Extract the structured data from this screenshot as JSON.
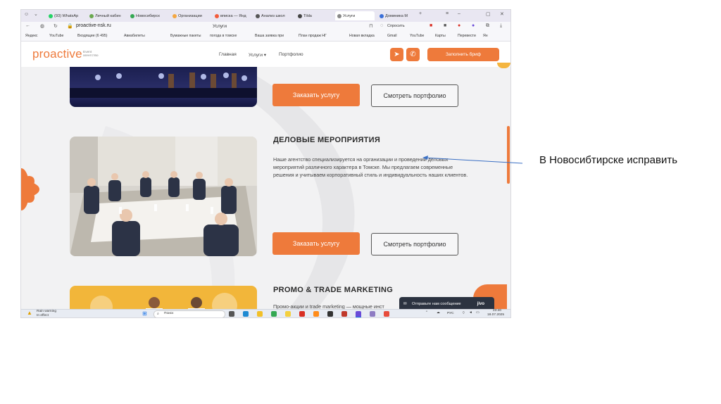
{
  "browser": {
    "tabs": [
      {
        "label": "(93) WhatsAp",
        "color": "#25d366"
      },
      {
        "label": "Личный кабин",
        "color": "#6aa84f"
      },
      {
        "label": "Новосибирск",
        "color": "#34a853"
      },
      {
        "label": "Организации",
        "color": "#f4a742"
      },
      {
        "label": "вписка — Янд",
        "color": "#f25c3b"
      },
      {
        "label": "Анализ школ",
        "color": "#555555"
      },
      {
        "label": "Tilda",
        "color": "#444444"
      },
      {
        "label": "Услуги",
        "color": "#888888"
      },
      {
        "label": "Доминика М",
        "color": "#3b6fd8"
      }
    ],
    "url": "proactive-nsk.ru",
    "page_title": "Услуги",
    "ask_label": "Спросить",
    "bookmarks": [
      "Яндекс",
      "YouTube",
      "Входящие (6 495)",
      "Авиабилеты",
      "Бумажные пакеты",
      "погода в томске",
      "Ваша заявка при",
      "План продаж НГ",
      "Новая вкладка",
      "Gmail",
      "YouTube",
      "Карты",
      "Перевести",
      "Ян"
    ]
  },
  "site": {
    "logo": "proactive",
    "logo_sub_1": "Event",
    "logo_sub_2": "агентство",
    "nav": [
      "Главная",
      "Услуги ▾",
      "Портфолио"
    ],
    "brief_button": "Заполнить бриф",
    "order_button": "Заказать услугу",
    "portfolio_button": "Смотреть портфолио",
    "section_business": {
      "title": "ДЕЛОВЫЕ МЕРОПРИЯТИЯ",
      "text": "Наше агентство специализируется на организации и проведении деловых мероприятий различного характера в Томске. Мы предлагаем современные решения и учитываем корпоративный стиль и индивидуальность наших клиентов."
    },
    "section_promo": {
      "title": "PROMO & TRADE MARKETING",
      "text": "Промо-акции и trade marketing — мощные инст"
    },
    "jivo": {
      "label": "Отправьте нам сообщение",
      "brand": "jivo"
    }
  },
  "taskbar": {
    "weather_title": "Rain warning",
    "weather_sub": "In effect",
    "search": "Поиск",
    "lang": "РУС",
    "time": "23:40",
    "date": "18.07.2025"
  },
  "annotation": "В Новосибтирске исправить",
  "colors": {
    "accent": "#ee7a3b",
    "arrow": "#3a6fc4"
  }
}
